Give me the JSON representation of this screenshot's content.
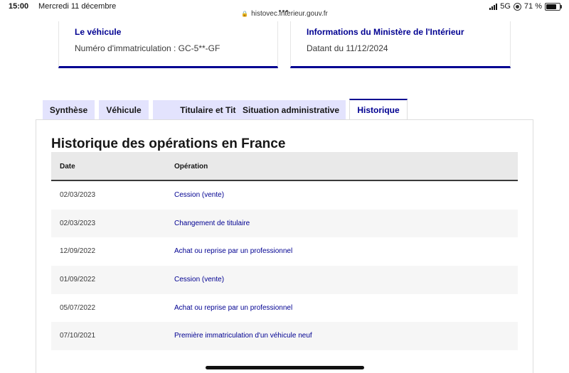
{
  "status_bar": {
    "time": "15:00",
    "date": "Mercredi 11 décembre",
    "url": "histovec.interieur.gouv.fr",
    "network": "5G",
    "battery": "71 %",
    "battery_level": 0.71
  },
  "cards": {
    "vehicle": {
      "title": "Le véhicule",
      "text": "Numéro d'immatriculation : GC-5**-GF"
    },
    "ministry": {
      "title": "Informations du Ministère de l'Intérieur",
      "text": "Datant du 11/12/2024"
    }
  },
  "tabs": [
    {
      "label": "Synthèse"
    },
    {
      "label": "Véhicule"
    },
    {
      "label": "Titulaire et Titre"
    },
    {
      "label": "Situation administrative"
    },
    {
      "label": "Historique",
      "active": true
    }
  ],
  "history": {
    "title": "Historique des opérations en France",
    "columns": [
      "Date",
      "Opération"
    ],
    "rows": [
      {
        "date": "02/03/2023",
        "operation": "Cession (vente)"
      },
      {
        "date": "02/03/2023",
        "operation": "Changement de titulaire"
      },
      {
        "date": "12/09/2022",
        "operation": "Achat ou reprise par un professionnel"
      },
      {
        "date": "01/09/2022",
        "operation": "Cession (vente)"
      },
      {
        "date": "05/07/2022",
        "operation": "Achat ou reprise par un professionnel"
      },
      {
        "date": "07/10/2021",
        "operation": "Première immatriculation d'un véhicule neuf"
      }
    ]
  },
  "colors": {
    "accent": "#000091",
    "tab_bg": "#e3e3fd",
    "header_bg": "#e9e9e9"
  }
}
